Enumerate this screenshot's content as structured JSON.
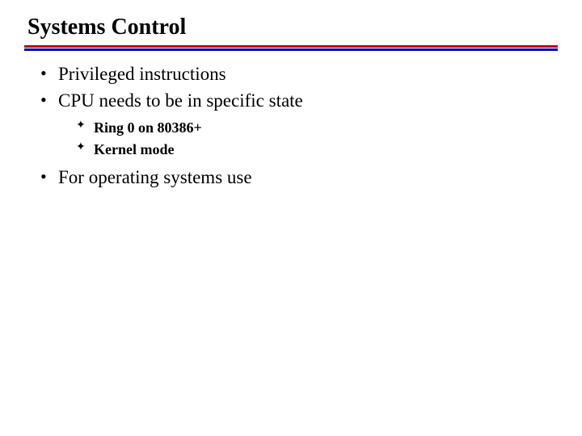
{
  "slide": {
    "title": "Systems Control",
    "bullets": [
      {
        "text": "Privileged instructions"
      },
      {
        "text": "CPU needs to be in specific state"
      },
      {
        "text": "For operating systems use"
      }
    ],
    "sub_bullets": [
      {
        "text": "Ring 0 on 80386+"
      },
      {
        "text": "Kernel mode"
      }
    ]
  }
}
